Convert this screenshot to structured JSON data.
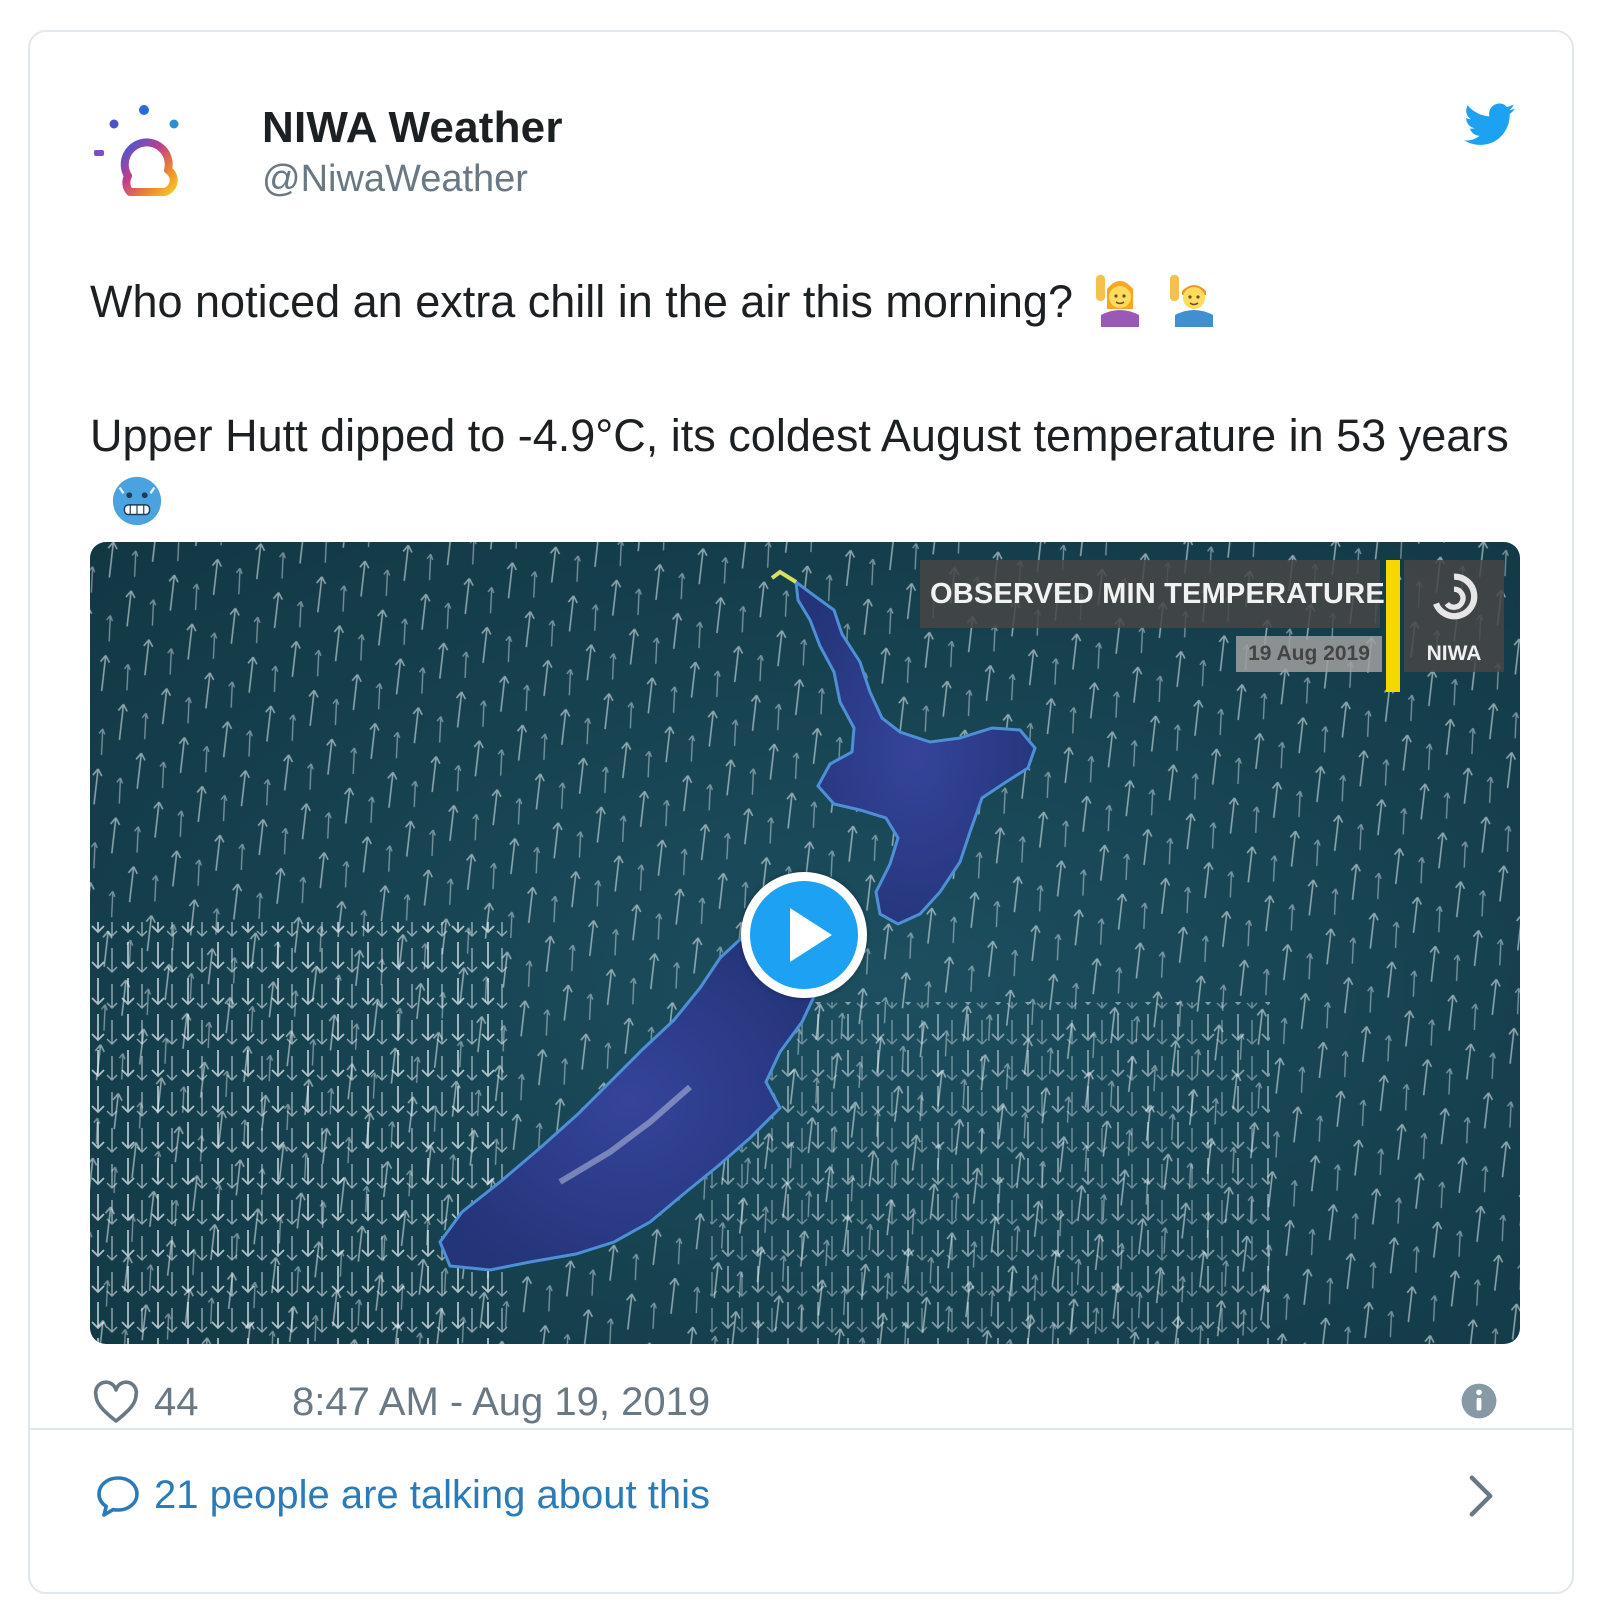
{
  "author": {
    "name": "NIWA Weather",
    "handle": "@NiwaWeather"
  },
  "tweet": {
    "line1": "Who noticed an extra chill in the air this morning?",
    "line2": "Upper Hutt dipped to -4.9°C, its coldest August temperature in 53 years",
    "emojis": [
      "woman-raising-hand",
      "man-raising-hand",
      "cold-face"
    ]
  },
  "media": {
    "overlay_title": "OBSERVED MIN TEMPERATURE",
    "overlay_date": "19 Aug  2019",
    "logo_text": "NIWA",
    "type": "video"
  },
  "meta": {
    "likes": "44",
    "timestamp": "8:47 AM - Aug 19, 2019"
  },
  "footer": {
    "talking": "21 people are talking about this"
  },
  "colors": {
    "twitter_blue": "#1da1f2",
    "link_blue": "#2b7bb9",
    "muted": "#697882",
    "ocean": "#16414f",
    "land": "#2a3a8e",
    "accent_yellow": "#f4d800"
  }
}
